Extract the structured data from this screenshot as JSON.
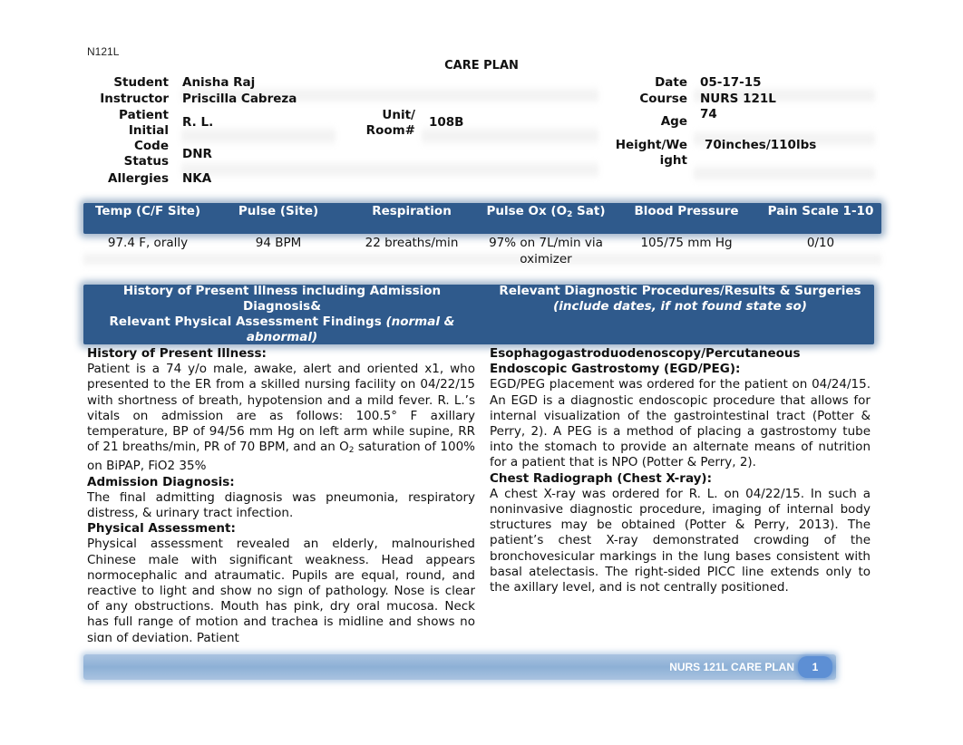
{
  "doc_code": "N121L",
  "title": "CARE PLAN",
  "info": {
    "student_label": "Student",
    "student": "Anisha Raj",
    "instructor_label": "Instructor",
    "instructor": "Priscilla Cabreza",
    "patient_label_1": "Patient",
    "patient_label_2": "Initial",
    "patient": "R. L.",
    "unit_label_1": "Unit/",
    "unit_label_2": "Room#",
    "unit": "108B",
    "code_label_1": "Code",
    "code_label_2": "Status",
    "code": "DNR",
    "allergies_label": "Allergies",
    "allergies": "NKA",
    "date_label": "Date",
    "date": "05-17-15",
    "course_label": "Course",
    "course": "NURS 121L",
    "age_label": "Age",
    "age": "74",
    "hw_label_1": "Height/We",
    "hw_label_2": "ight",
    "hw": "70inches/110lbs"
  },
  "vitals": {
    "headers": [
      "Temp  (C/F Site)",
      "Pulse  (Site)",
      "Respiration",
      "Pulse Ox (O",
      "Blood Pressure",
      "Pain Scale 1-10"
    ],
    "pulse_ox_sub": "2",
    "pulse_ox_tail": " Sat)",
    "values": [
      "97.4 F, orally",
      "94 BPM",
      "22 breaths/min",
      "97% on 7L/min via oximizer",
      "105/75 mm Hg",
      "0/10"
    ]
  },
  "left_section": {
    "header_line1": "History of Present Illness including Admission Diagnosis&",
    "header_line2": "Relevant Physical Assessment Findings ",
    "header_italic": "(normal & abnormal)",
    "hpi_title": "History of Present Illness:",
    "hpi_text_a": "Patient is a 74 y/o male, awake, alert and oriented x1, who presented to the ER from a skilled nursing facility on 04/22/15 with shortness of breath, hypotension and a mild fever.   R. L.’s vitals on admission are as follows: 100.5° F axillary temperature, BP of 94/56 mm Hg on left arm while supine, RR of 21 breaths/min, PR of 70 BPM, and an O",
    "hpi_sub": "2",
    "hpi_text_b": " saturation of 100% on BiPAP, FiO2 35%",
    "adm_title": "Admission Diagnosis:",
    "adm_text": "The final admitting diagnosis was pneumonia, respiratory distress, & urinary tract infection.",
    "pa_title": "Physical Assessment:",
    "pa_text": "Physical assessment revealed an elderly, malnourished Chinese male with significant weakness. Head appears normocephalic and atraumatic.  Pupils are equal, round, and reactive to light and show no sign of pathology. Nose is clear of any obstructions.  Mouth has pink, dry oral mucosa.  Neck has full range of motion and trachea is midline and shows no sign of deviation. Patient"
  },
  "right_section": {
    "header_line1": "Relevant Diagnostic Procedures/Results & Surgeries",
    "header_italic": "(include dates, if not found state so)",
    "egd_title": "Esophagogastroduodenoscopy/Percutaneous Endoscopic Gastrostomy (EGD/PEG):",
    "egd_text": "EGD/PEG placement was ordered for the patient on 04/24/15.  An EGD is a diagnostic endoscopic procedure that allows for internal visualization of the gastrointestinal tract (Potter & Perry, 2).  A PEG is a method of placing a gastrostomy tube into the stomach to provide an alternate means of nutrition for a patient that is NPO (Potter & Perry, 2).",
    "cxr_title": "Chest Radiograph (Chest X-ray):",
    "cxr_text": "A chest X-ray was ordered for R. L. on 04/22/15.  In such a noninvasive diagnostic procedure, imaging of internal body structures may be obtained (Potter & Perry, 2013).  The patient’s chest X-ray demonstrated crowding of the bronchovesicular markings in the lung bases consistent with basal atelectasis.  The right-sided PICC line extends only to the axillary level, and is not centrally positioned."
  },
  "footer": {
    "text": "NURS 121L CARE PLAN",
    "page": "1"
  }
}
